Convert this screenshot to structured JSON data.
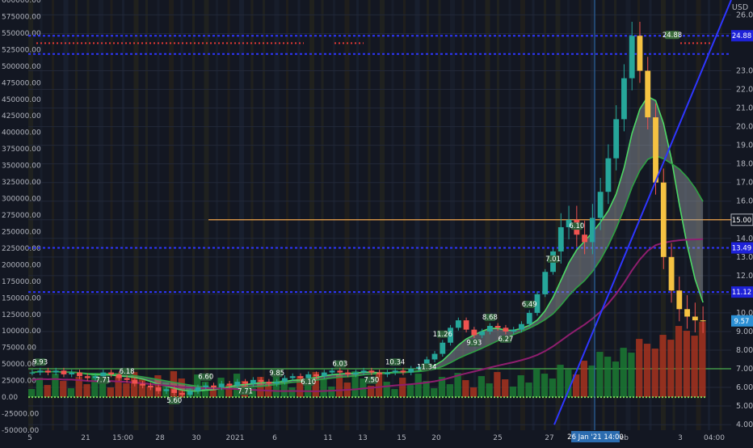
{
  "chart_data": {
    "type": "candlestick",
    "right_axis": {
      "label": "USD",
      "ticks": [
        "26.00",
        "25.00",
        "23.00",
        "22.00",
        "21.00",
        "20.00",
        "19.00",
        "18.00",
        "17.00",
        "16.00",
        "15.00",
        "14.00",
        "13.00",
        "12.00",
        "11.00",
        "10.00",
        "9.00",
        "8.00",
        "7.00",
        "6.00",
        "5.00",
        "4.00"
      ],
      "range": [
        3.7,
        26.8
      ],
      "price_badges": [
        {
          "value": "24.88",
          "color": "#1e22d8"
        },
        {
          "value": "15.00",
          "color": "#131722"
        },
        {
          "value": "13.49",
          "color": "#1e22d8"
        },
        {
          "value": "11.12",
          "color": "#1e22d8"
        },
        {
          "value": "9.57",
          "color": "#2b8fd4"
        }
      ]
    },
    "left_axis": {
      "ticks": [
        "600000.00",
        "575000.00",
        "550000.00",
        "525000.00",
        "500000.00",
        "475000.00",
        "450000.00",
        "425000.00",
        "400000.00",
        "375000.00",
        "350000.00",
        "325000.00",
        "300000.00",
        "275000.00",
        "250000.00",
        "225000.00",
        "200000.00",
        "175000.00",
        "150000.00",
        "125000.00",
        "100000.00",
        "75000.00",
        "50000.00",
        "25000.00",
        "0.00",
        "-25000.00",
        "-50000.00"
      ],
      "range": [
        -50000,
        600000
      ]
    },
    "x_axis": {
      "ticks": [
        "5",
        "21",
        "15:00",
        "28",
        "30",
        "2021",
        "6",
        "11",
        "13",
        "15",
        "20",
        "25",
        "27",
        "Feb",
        "3",
        "04:00"
      ],
      "crosshair_label": "26 Jan '21  14:00"
    },
    "series": [
      {
        "name": "",
        "values": [
          6.8,
          6.9,
          6.8,
          6.9,
          6.7,
          6.8,
          6.6,
          6.5,
          6.6,
          6.8,
          6.7,
          6.5,
          6.4,
          6.2,
          6.1,
          6.0,
          5.8,
          5.9,
          5.7,
          5.6,
          5.8,
          6.0,
          6.1,
          6.0,
          6.2,
          6.1,
          6.3,
          6.2,
          6.4,
          6.3,
          6.2,
          6.3,
          6.5,
          6.6,
          6.5,
          6.7,
          6.6,
          6.8,
          6.9,
          6.8,
          6.7,
          6.8,
          6.9,
          6.8,
          6.7,
          6.8,
          6.9,
          6.8,
          7.0,
          7.1,
          7.5,
          7.8,
          8.4,
          9.2,
          9.6,
          9.1,
          8.8,
          9.0,
          9.3,
          9.2,
          9.0,
          9.1,
          9.4,
          10.0,
          11.0,
          12.2,
          13.3,
          14.6,
          15.0,
          14.2,
          13.8,
          15.1,
          16.5,
          18.3,
          20.4,
          22.6,
          24.88,
          23.0,
          20.5,
          17.0,
          13.0,
          11.2,
          10.2,
          9.8,
          9.6,
          9.57
        ]
      }
    ],
    "levels": [
      24.88,
      23.9,
      15.0,
      13.49,
      11.12,
      7.0
    ],
    "trendline": {
      "from": [
        4.0,
        4.0
      ],
      "to": [
        26.8,
        26.8
      ]
    },
    "annotations": {
      "top_badge": "24.88",
      "small_badges": [
        "9.93",
        "7.71",
        "6.18",
        "5.60",
        "6.60",
        "7.71",
        "9.85",
        "6.10",
        "6.03",
        "7.50",
        "10.34",
        "11.34",
        "11.26",
        "9.93",
        "8.68",
        "6.27",
        "6.49",
        "7.01",
        "6.10"
      ]
    },
    "volume_histogram": true,
    "grid": true
  }
}
